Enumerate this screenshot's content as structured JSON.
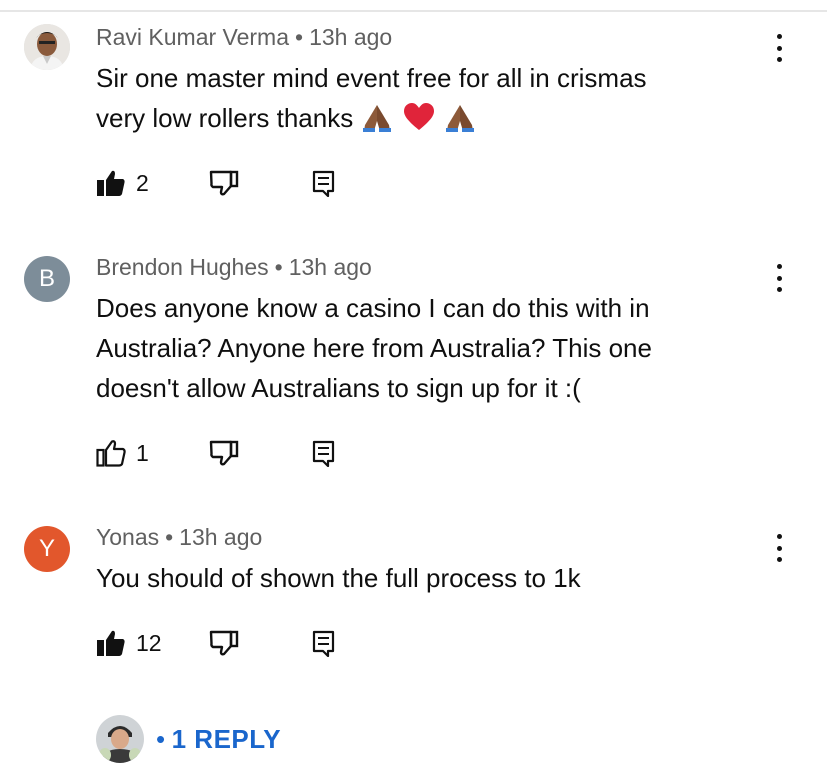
{
  "comments": [
    {
      "author": "Ravi Kumar Verma",
      "time": "13h ago",
      "text_line1": "Sir one master mind event free for all in crismas",
      "text_line2": "very low rollers  thanks",
      "emojis": [
        "folded-hands-icon",
        "red-heart-icon",
        "folded-hands-icon"
      ],
      "likes": "2",
      "like_filled": true,
      "avatar_icon": "user-photo-avatar"
    },
    {
      "author": "Brendon Hughes",
      "time": "13h ago",
      "text_lines": [
        "Does anyone know a casino I can do this with in",
        "Australia? Anyone here from Australia? This one",
        "doesn't allow Australians to sign up for it :("
      ],
      "likes": "1",
      "like_filled": false,
      "avatar_letter": "B",
      "avatar_color": "#7d8d99"
    },
    {
      "author": "Yonas",
      "time": "13h ago",
      "text": "You should of shown the full process to 1k",
      "likes": "12",
      "like_filled": true,
      "avatar_letter": "Y",
      "avatar_color": "#e2572c"
    }
  ],
  "replies": {
    "bullet": "•",
    "label": "1 REPLY",
    "color": "#1a66cc"
  },
  "separator": "•"
}
